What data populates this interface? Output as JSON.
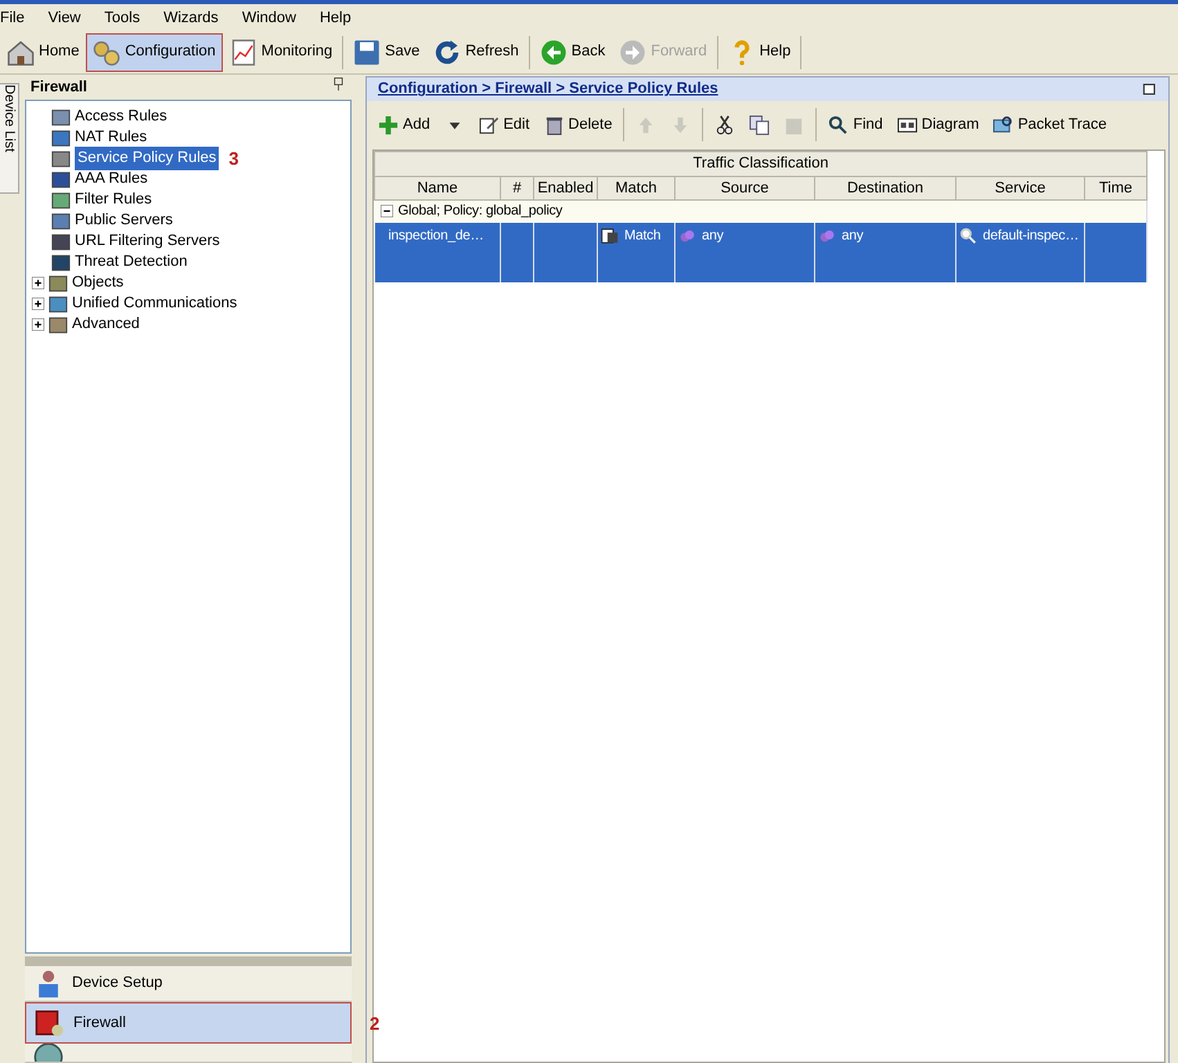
{
  "menu": [
    "File",
    "View",
    "Tools",
    "Wizards",
    "Window",
    "Help"
  ],
  "toolbar": [
    {
      "label": "Home",
      "selected": false,
      "disabled": false,
      "outlined": false
    },
    {
      "label": "Configuration",
      "selected": true,
      "disabled": false,
      "outlined": true
    },
    {
      "label": "Monitoring",
      "selected": false,
      "disabled": false,
      "outlined": false
    },
    {
      "label": "Save",
      "selected": false,
      "disabled": false,
      "outlined": false
    },
    {
      "label": "Refresh",
      "selected": false,
      "disabled": false,
      "outlined": false
    },
    {
      "label": "Back",
      "selected": false,
      "disabled": false,
      "outlined": false
    },
    {
      "label": "Forward",
      "selected": false,
      "disabled": true,
      "outlined": false
    },
    {
      "label": "Help",
      "selected": false,
      "disabled": false,
      "outlined": false
    }
  ],
  "side_tab": "Device List",
  "left_panel": {
    "title": "Firewall",
    "tree": [
      {
        "label": "Access Rules",
        "selected": false
      },
      {
        "label": "NAT Rules",
        "selected": false
      },
      {
        "label": "Service Policy Rules",
        "selected": true,
        "callout": "3"
      },
      {
        "label": "AAA Rules",
        "selected": false
      },
      {
        "label": "Filter Rules",
        "selected": false
      },
      {
        "label": "Public Servers",
        "selected": false
      },
      {
        "label": "URL Filtering Servers",
        "selected": false
      },
      {
        "label": "Threat Detection",
        "selected": false
      },
      {
        "label": "Objects",
        "selected": false,
        "expanded": false
      },
      {
        "label": "Unified Communications",
        "selected": false,
        "expanded": false
      },
      {
        "label": "Advanced",
        "selected": false,
        "expanded": false
      }
    ],
    "nav": [
      {
        "label": "Device Setup",
        "selected": false,
        "outlined": false
      },
      {
        "label": "Firewall",
        "selected": true,
        "outlined": true,
        "callout": "2"
      }
    ]
  },
  "main": {
    "breadcrumb": "Configuration > Firewall > Service Policy Rules",
    "toolbar": [
      {
        "label": "Add",
        "disabled": false
      },
      {
        "disabled": false
      },
      {
        "label": "Edit",
        "disabled": false
      },
      {
        "label": "Delete",
        "disabled": false
      },
      {
        "disabled": true
      },
      {
        "disabled": true
      },
      {
        "disabled": false
      },
      {
        "disabled": false
      },
      {
        "disabled": true
      },
      {
        "label": "Find",
        "disabled": false
      },
      {
        "label": "Diagram",
        "disabled": false
      },
      {
        "label": "Packet Trace",
        "disabled": false
      }
    ],
    "table": {
      "group_header": "Traffic Classification",
      "columns": [
        "Name",
        "#",
        "Enabled",
        "Match",
        "Source",
        "Destination",
        "Service",
        "Time"
      ],
      "groups": [
        {
          "label": "Global; Policy: global_policy",
          "expanded": true,
          "rows": [
            {
              "selected": true,
              "cells": [
                "inspection_de…",
                "",
                "",
                "Match",
                "any",
                "any",
                "default-inspec…",
                ""
              ]
            }
          ]
        }
      ]
    }
  }
}
